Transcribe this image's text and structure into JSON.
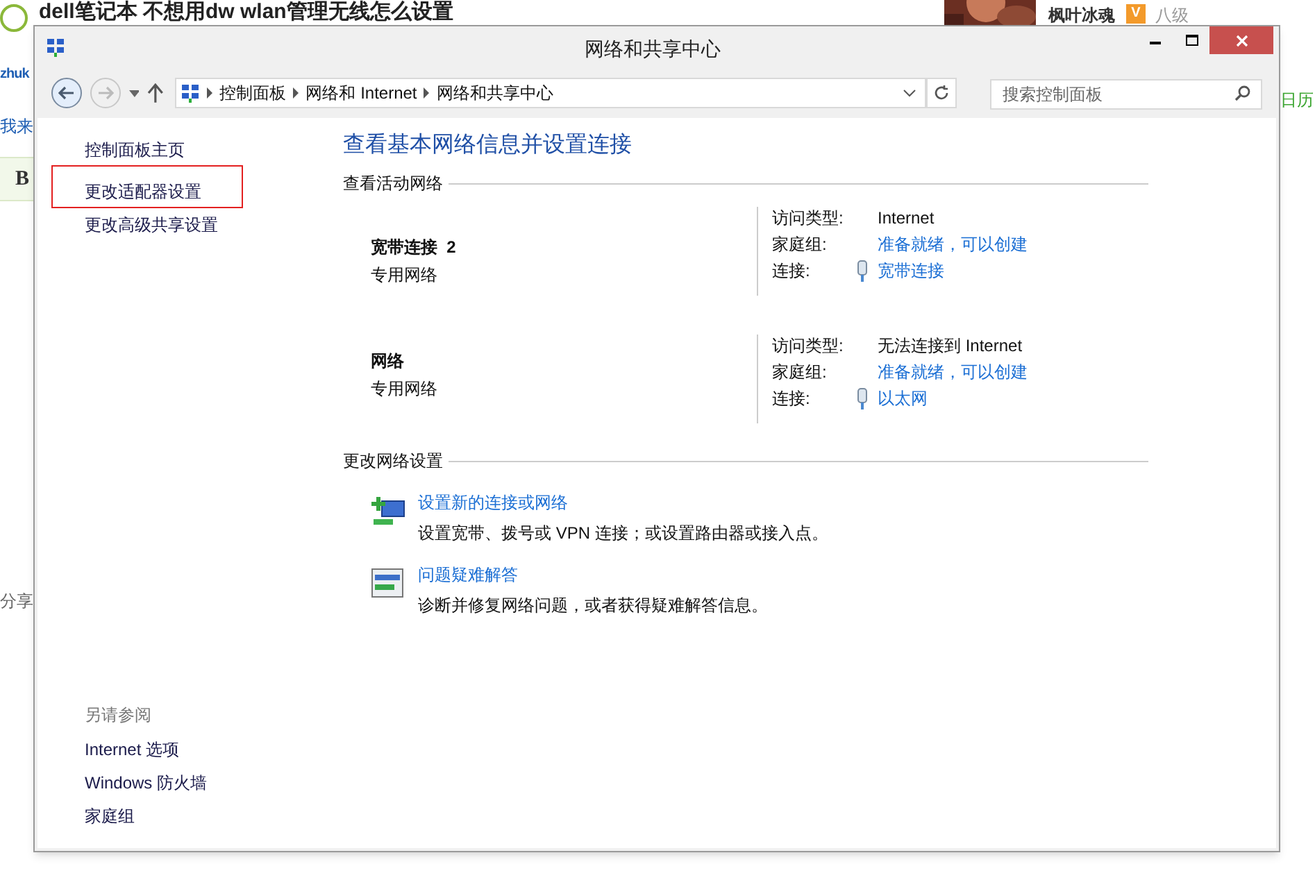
{
  "background": {
    "article_title": "dell笔记本 不想用dw wlan管理无线怎么设置",
    "left_fragments": [
      "zhuk",
      "我来",
      "B",
      "分享"
    ],
    "user_name": "枫叶冰魂",
    "user_badge": "V",
    "user_level": "八级",
    "right_fragment": "日历"
  },
  "window": {
    "title": "网络和共享中心"
  },
  "address": {
    "crumbs": [
      "控制面板",
      "网络和 Internet",
      "网络和共享中心"
    ],
    "search": {
      "placeholder": "搜索控制面板"
    }
  },
  "sidebar": {
    "items": [
      {
        "label": "控制面板主页",
        "highlighted": false
      },
      {
        "label": "更改适配器设置",
        "highlighted": true
      },
      {
        "label": "更改高级共享设置",
        "highlighted": false
      }
    ],
    "see_also": {
      "heading": "另请参阅",
      "items": [
        "Internet 选项",
        "Windows 防火墙",
        "家庭组"
      ]
    }
  },
  "main": {
    "heading": "查看基本网络信息并设置连接",
    "active_section": "查看活动网络",
    "networks": [
      {
        "name": "宽带连接  2",
        "type": "专用网络",
        "details": [
          {
            "label": "访问类型:",
            "value": "Internet",
            "kind": "text"
          },
          {
            "label": "家庭组:",
            "value": "准备就绪，可以创建",
            "kind": "link"
          },
          {
            "label": "连接:",
            "value": "宽带连接",
            "kind": "connection"
          }
        ]
      },
      {
        "name": "网络",
        "type": "专用网络",
        "details": [
          {
            "label": "访问类型:",
            "value": "无法连接到 Internet",
            "kind": "text"
          },
          {
            "label": "家庭组:",
            "value": "准备就绪，可以创建",
            "kind": "link"
          },
          {
            "label": "连接:",
            "value": "以太网",
            "kind": "connection"
          }
        ]
      }
    ],
    "settings_section": "更改网络设置",
    "tasks": [
      {
        "kind": "new_connection",
        "title": "设置新的连接或网络",
        "description": "设置宽带、拨号或 VPN 连接；或设置路由器或接入点。"
      },
      {
        "kind": "troubleshoot",
        "title": "问题疑难解答",
        "description": "诊断并修复网络问题，或者获得疑难解答信息。"
      }
    ]
  }
}
